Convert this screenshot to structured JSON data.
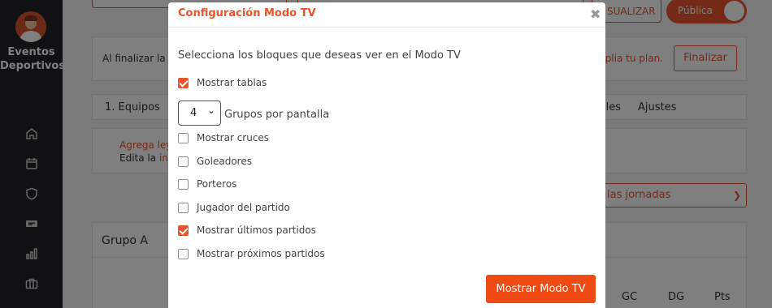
{
  "sidebar": {
    "brand_line1": "Eventos",
    "brand_line2": "Deportivos",
    "nav_icons": [
      "home-icon",
      "calendar-icon",
      "shield-icon",
      "ticket-icon",
      "stats-icon",
      "briefcase-icon"
    ]
  },
  "header": {
    "visualizar_label": "SUALIZAR",
    "publica_label": "Pública"
  },
  "finish_card": {
    "text": "Al finalizar la co",
    "upgrade_link": "mplia tu plan.",
    "finish_button": "Finalizar"
  },
  "tabs": {
    "first": "1. Equipos",
    "details": "alles",
    "settings": "Ajustes"
  },
  "legend_card": {
    "line1": "Agrega leye",
    "line2_prefix": "Edita la ",
    "line2_link": "info"
  },
  "jornadas_select": {
    "value": "las jornadas"
  },
  "group_card": {
    "title": "Grupo A",
    "columns": [
      "GC",
      "DG",
      "Pts"
    ]
  },
  "modal": {
    "title": "Configuración Modo TV",
    "close_symbol": "✖",
    "description": "Selecciona los bloques que deseas ver en el Modo TV",
    "options": [
      {
        "label": "Mostrar tablas",
        "checked": true
      },
      {
        "label": "Mostrar cruces",
        "checked": false
      },
      {
        "label": "Goleadores",
        "checked": false
      },
      {
        "label": "Porteros",
        "checked": false
      },
      {
        "label": "Jugador del partido",
        "checked": false
      },
      {
        "label": "Mostrar últimos partidos",
        "checked": true
      },
      {
        "label": "Mostrar próximos partidos",
        "checked": false
      }
    ],
    "groups_per_screen": {
      "value": "4",
      "label": "Grupos por pantalla"
    },
    "submit_button": "Mostrar Modo TV"
  },
  "colors": {
    "accent": "#e8542c",
    "sidebar_bg": "#1f2326"
  }
}
